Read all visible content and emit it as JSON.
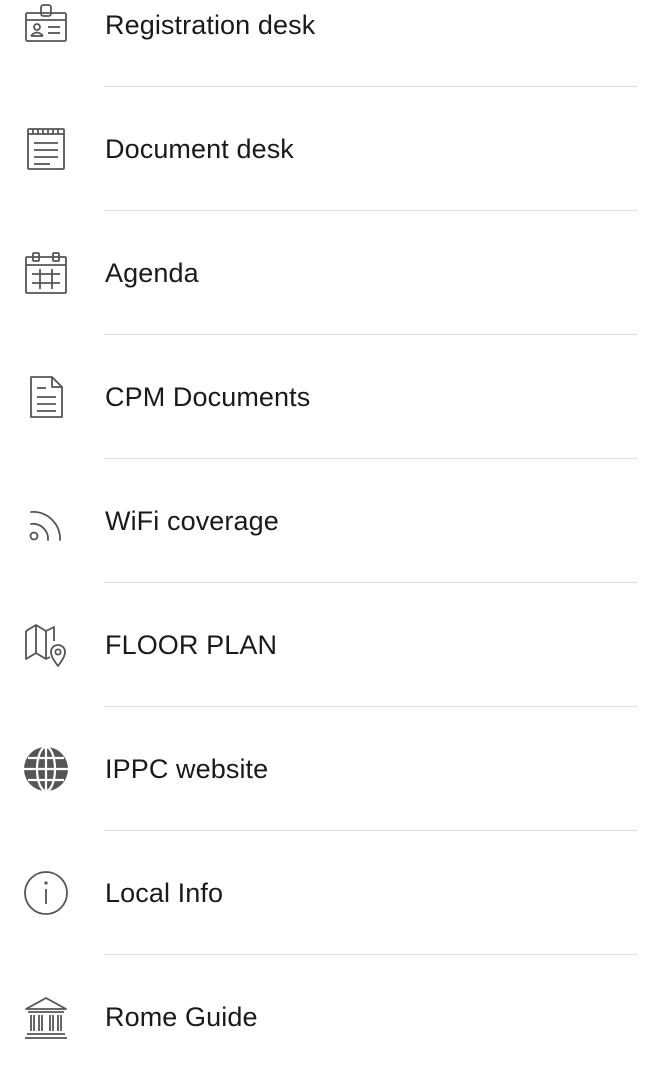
{
  "menu": {
    "items": [
      {
        "label": "Registration desk",
        "icon": "id-badge-icon"
      },
      {
        "label": "Document desk",
        "icon": "document-desk-icon"
      },
      {
        "label": "Agenda",
        "icon": "calendar-icon"
      },
      {
        "label": "CPM Documents",
        "icon": "document-icon"
      },
      {
        "label": "WiFi coverage",
        "icon": "wifi-icon"
      },
      {
        "label": "FLOOR PLAN",
        "icon": "map-pin-icon"
      },
      {
        "label": "IPPC website",
        "icon": "globe-icon"
      },
      {
        "label": "Local Info",
        "icon": "info-icon"
      },
      {
        "label": "Rome Guide",
        "icon": "museum-icon"
      }
    ]
  },
  "colors": {
    "icon": "#555555",
    "text": "#1a1a1a",
    "divider": "#dcdcdc",
    "background": "#ffffff"
  }
}
